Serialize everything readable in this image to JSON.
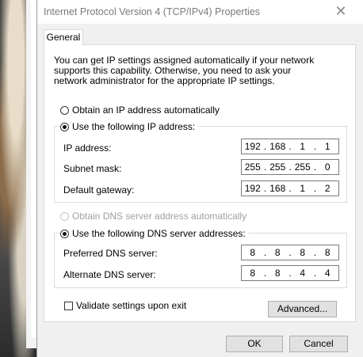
{
  "window": {
    "title": "Internet Protocol Version 4 (TCP/IPv4) Properties"
  },
  "tabs": [
    {
      "label": "General"
    }
  ],
  "description": "You can get IP settings assigned automatically if your network supports this capability. Otherwise, you need to ask your network administrator for the appropriate IP settings.",
  "ip": {
    "auto_label": "Obtain an IP address automatically",
    "manual_label": "Use the following IP address:",
    "mode": "manual",
    "address_label": "IP address:",
    "address": [
      "192",
      "168",
      "1",
      "1"
    ],
    "subnet_label": "Subnet mask:",
    "subnet": [
      "255",
      "255",
      "255",
      "0"
    ],
    "gateway_label": "Default gateway:",
    "gateway": [
      "192",
      "168",
      "1",
      "2"
    ]
  },
  "dns": {
    "auto_label": "Obtain DNS server address automatically",
    "manual_label": "Use the following DNS server addresses:",
    "mode": "manual",
    "preferred_label": "Preferred DNS server:",
    "preferred": [
      "8",
      "8",
      "8",
      "8"
    ],
    "alternate_label": "Alternate DNS server:",
    "alternate": [
      "8",
      "8",
      "4",
      "4"
    ]
  },
  "validate": {
    "label": "Validate settings upon exit",
    "checked": false
  },
  "buttons": {
    "advanced": "Advanced...",
    "ok": "OK",
    "cancel": "Cancel"
  },
  "icons": {
    "close": "close-icon"
  }
}
